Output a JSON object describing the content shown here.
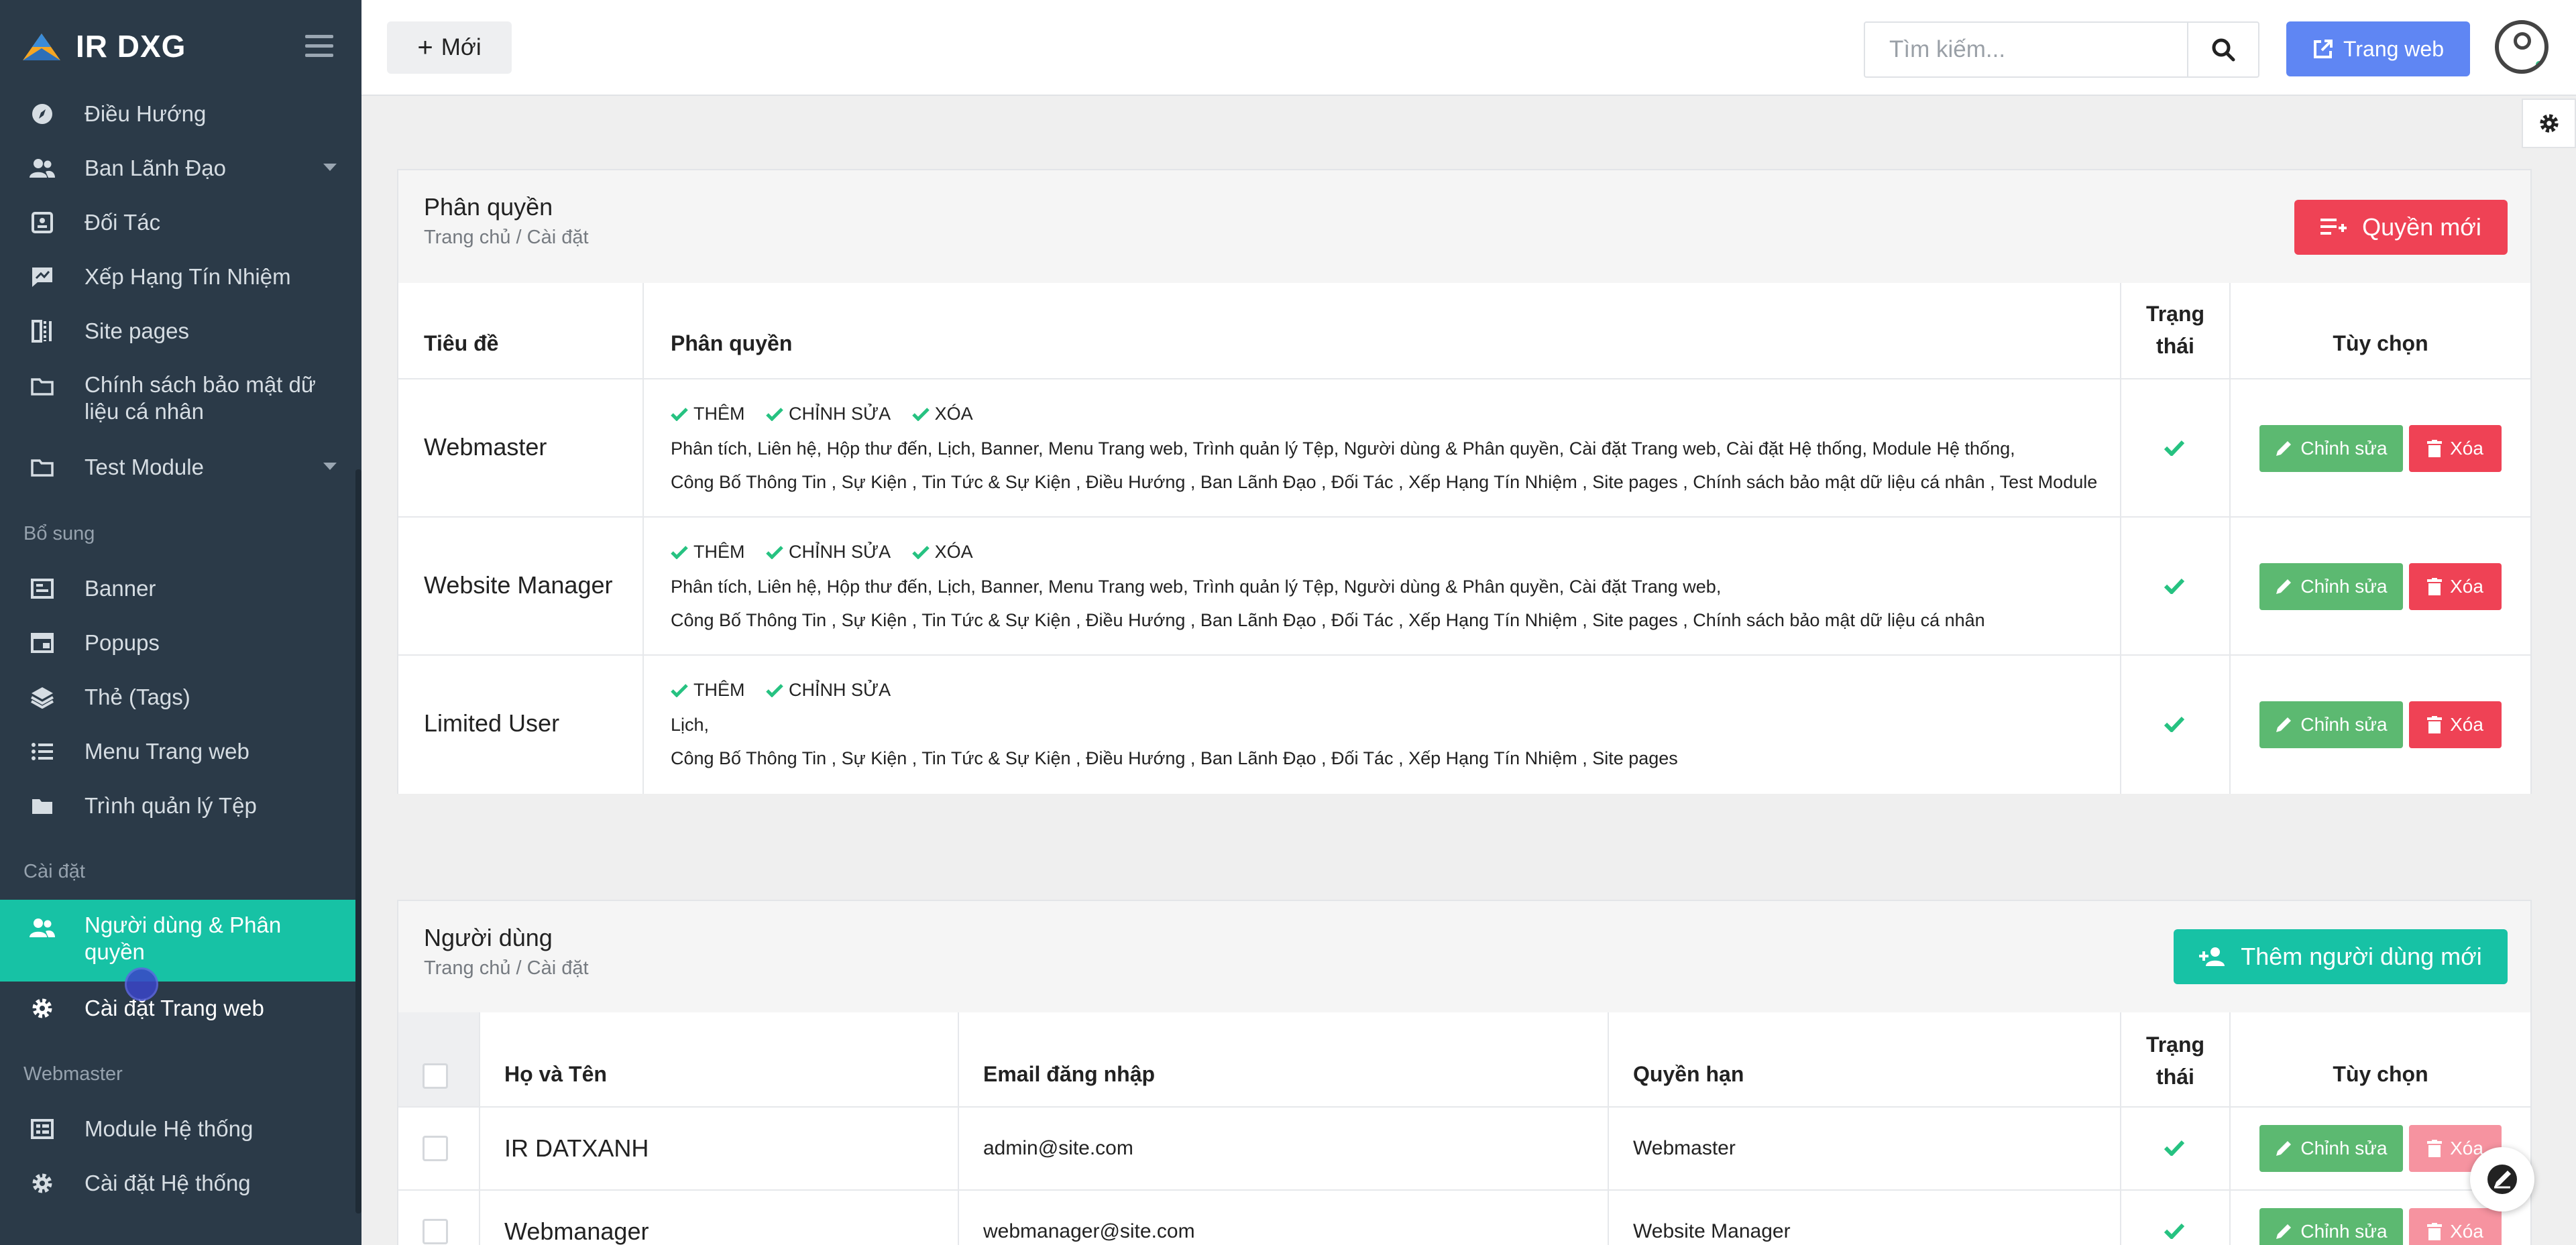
{
  "app": {
    "brand": "IR DXG"
  },
  "sidebar": {
    "items": [
      {
        "label": "Điều Hướng",
        "icon": "compass-icon"
      },
      {
        "label": "Ban Lãnh Đạo",
        "icon": "users-icon"
      },
      {
        "label": "Đối Tác",
        "icon": "id-card-icon"
      },
      {
        "label": "Xếp Hạng Tín Nhiệm",
        "icon": "rating-icon"
      },
      {
        "label": "Site pages",
        "icon": "pages-icon"
      },
      {
        "label": "Chính sách bảo mật dữ liệu cá nhân",
        "icon": "folder-icon"
      },
      {
        "label": "Test Module",
        "icon": "folder-icon"
      }
    ],
    "section_bosung": "Bổ sung",
    "bosung_items": [
      {
        "label": "Banner",
        "icon": "image-icon"
      },
      {
        "label": "Popups",
        "icon": "window-icon"
      },
      {
        "label": "Thẻ (Tags)",
        "icon": "layers-icon"
      },
      {
        "label": "Menu Trang web",
        "icon": "list-icon"
      },
      {
        "label": "Trình quản lý Tệp",
        "icon": "folder-icon"
      }
    ],
    "section_caidat": "Cài đặt",
    "caidat_items": [
      {
        "label": "Người dùng & Phân quyền",
        "icon": "users-icon"
      },
      {
        "label": "Cài đặt Trang web",
        "icon": "gear-icon"
      }
    ],
    "section_webmaster": "Webmaster",
    "webmaster_items": [
      {
        "label": "Module Hệ thống",
        "icon": "module-icon"
      },
      {
        "label": "Cài đặt Hệ thống",
        "icon": "gear-icon"
      }
    ]
  },
  "topbar": {
    "new_label": "Mới",
    "search_placeholder": "Tìm kiếm...",
    "website_label": "Trang web"
  },
  "permissions_card": {
    "title": "Phân quyền",
    "breadcrumb": "Trang chủ / Cài đặt",
    "new_button": "Quyền mới",
    "headers": {
      "title": "Tiêu đề",
      "permissions": "Phân quyền",
      "status_1": "Trạng",
      "status_2": "thái",
      "options": "Tùy chọn"
    },
    "rows": [
      {
        "title": "Webmaster",
        "tags": [
          "THÊM",
          "CHỈNH SỬA",
          "XÓA"
        ],
        "line1": "Phân tích, Liên hệ, Hộp thư đến, Lịch, Banner, Menu Trang web, Trình quản lý Tệp, Người dùng & Phân quyền, Cài đặt Trang web, Cài đặt Hệ thống, Module Hệ thống,",
        "line2": "Công Bố Thông Tin , Sự Kiện , Tin Tức & Sự Kiện , Điều Hướng , Ban Lãnh Đạo , Đối Tác , Xếp Hạng Tín Nhiệm , Site pages , Chính sách bảo mật dữ liệu cá nhân , Test Module"
      },
      {
        "title": "Website Manager",
        "tags": [
          "THÊM",
          "CHỈNH SỬA",
          "XÓA"
        ],
        "line1": "Phân tích, Liên hệ, Hộp thư đến, Lịch, Banner, Menu Trang web, Trình quản lý Tệp, Người dùng & Phân quyền, Cài đặt Trang web,",
        "line2": "Công Bố Thông Tin , Sự Kiện , Tin Tức & Sự Kiện , Điều Hướng , Ban Lãnh Đạo , Đối Tác , Xếp Hạng Tín Nhiệm , Site pages , Chính sách bảo mật dữ liệu cá nhân"
      },
      {
        "title": "Limited User",
        "tags": [
          "THÊM",
          "CHỈNH SỬA"
        ],
        "line1": "Lịch,",
        "line2": "Công Bố Thông Tin , Sự Kiện , Tin Tức & Sự Kiện , Điều Hướng , Ban Lãnh Đạo , Đối Tác , Xếp Hạng Tín Nhiệm , Site pages"
      }
    ],
    "edit_label": "Chỉnh sửa",
    "delete_label": "Xóa"
  },
  "users_card": {
    "title": "Người dùng",
    "breadcrumb": "Trang chủ / Cài đặt",
    "new_button": "Thêm người dùng mới",
    "headers": {
      "name": "Họ và Tên",
      "email": "Email đăng nhập",
      "role": "Quyền hạn",
      "status_1": "Trạng",
      "status_2": "thái",
      "options": "Tùy chọn"
    },
    "rows": [
      {
        "name": "IR DATXANH",
        "email": "admin@site.com",
        "role": "Webmaster"
      },
      {
        "name": "Webmanager",
        "email": "webmanager@site.com",
        "role": "Website Manager"
      }
    ],
    "edit_label": "Chỉnh sửa",
    "delete_label": "Xóa"
  },
  "colors": {
    "sidebar": "#2b3a48",
    "active": "#17c2a5",
    "danger": "#ef4255",
    "success": "#5cb971",
    "primary": "#5f86f3"
  }
}
